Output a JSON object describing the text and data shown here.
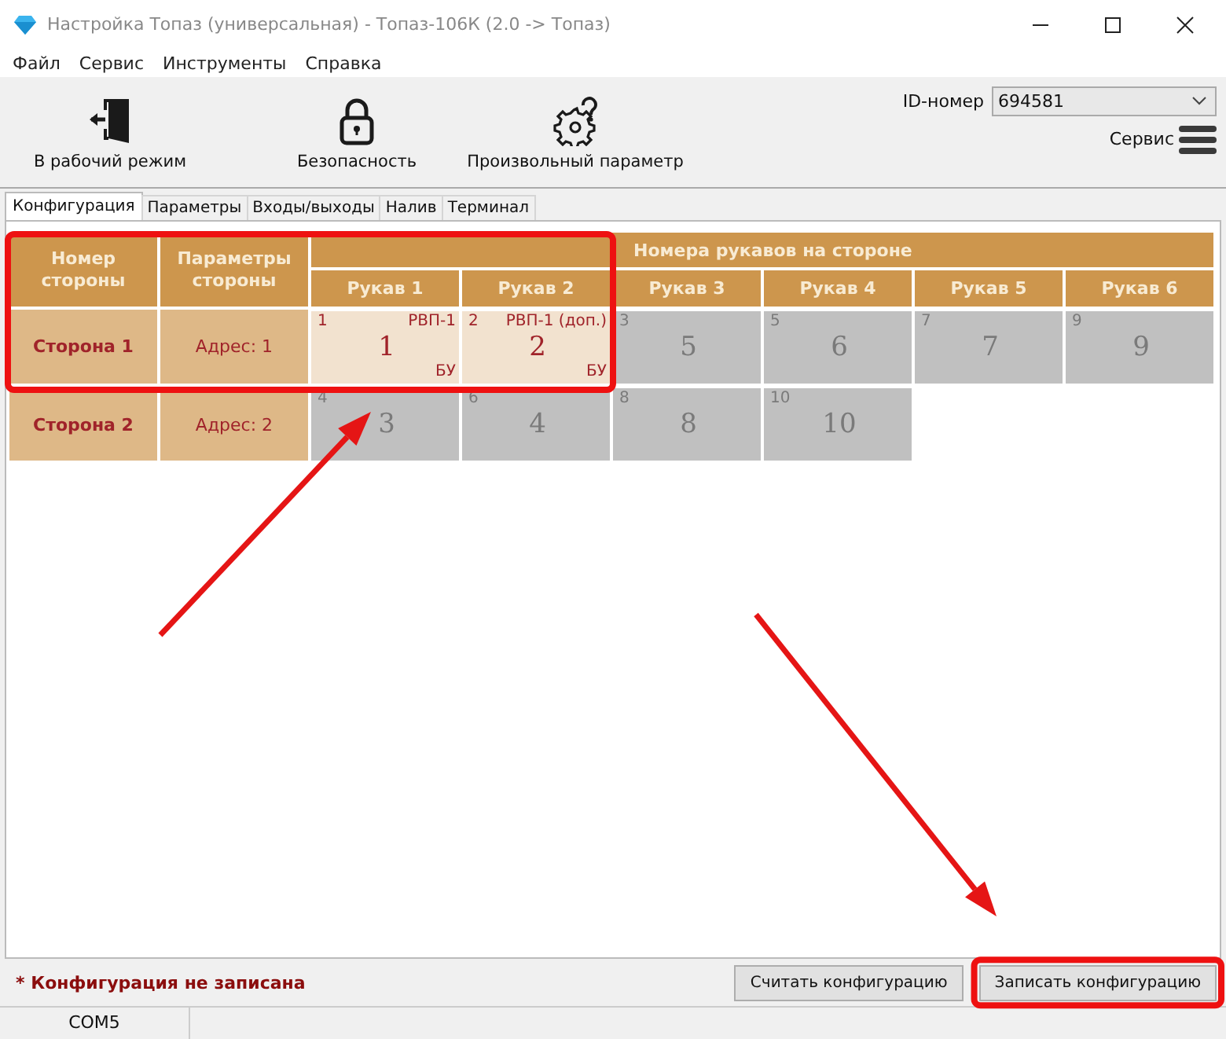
{
  "window": {
    "title": "Настройка Топаз (универсальная) - Топаз-106К (2.0 -> Топаз)"
  },
  "menu": [
    "Файл",
    "Сервис",
    "Инструменты",
    "Справка"
  ],
  "toolbar": [
    {
      "kind": "exit",
      "label": "В рабочий режим"
    },
    {
      "kind": "lock",
      "label": "Безопасность"
    },
    {
      "kind": "gear",
      "label": "Произвольный параметр"
    }
  ],
  "id_field": {
    "label": "ID-номер",
    "value": "694581"
  },
  "service": {
    "label": "Сервис"
  },
  "tabs": [
    {
      "label": "Конфигурация",
      "selected": true
    },
    {
      "label": "Параметры",
      "selected": false
    },
    {
      "label": "Входы/выходы",
      "selected": false
    },
    {
      "label": "Налив",
      "selected": false
    },
    {
      "label": "Терминал",
      "selected": false
    }
  ],
  "table": {
    "columns": [
      "Номер стороны",
      "Параметры стороны"
    ],
    "group_header": "Номера рукавов на стороне",
    "arm_columns": [
      "Рукав 1",
      "Рукав 2",
      "Рукав 3",
      "Рукав 4",
      "Рукав 5",
      "Рукав 6"
    ],
    "rows": [
      {
        "side": "Сторона 1",
        "address": "Адрес: 1",
        "cells": [
          {
            "index": "1",
            "number": "1",
            "type": "РВП-1",
            "unit": "БУ",
            "active": true
          },
          {
            "index": "2",
            "number": "2",
            "type": "РВП-1 (доп.)",
            "unit": "БУ",
            "active": true
          },
          {
            "index": "3",
            "number": "5",
            "active": false
          },
          {
            "index": "5",
            "number": "6",
            "active": false
          },
          {
            "index": "7",
            "number": "7",
            "active": false
          },
          {
            "index": "9",
            "number": "9",
            "active": false
          }
        ]
      },
      {
        "side": "Сторона 2",
        "address": "Адрес: 2",
        "cells": [
          {
            "index": "4",
            "number": "3",
            "active": false
          },
          {
            "index": "6",
            "number": "4",
            "active": false
          },
          {
            "index": "8",
            "number": "8",
            "active": false
          },
          {
            "index": "10",
            "number": "10",
            "active": false
          }
        ]
      }
    ]
  },
  "status_message": "* Конфигурация не записана",
  "buttons": [
    "Считать конфигурацию",
    "Записать конфигурацию"
  ],
  "status_bar": [
    "COM5"
  ],
  "annotations": [
    {
      "kind": "frame"
    },
    {
      "kind": "frame"
    },
    {
      "kind": "arrow"
    },
    {
      "kind": "arrow"
    }
  ]
}
